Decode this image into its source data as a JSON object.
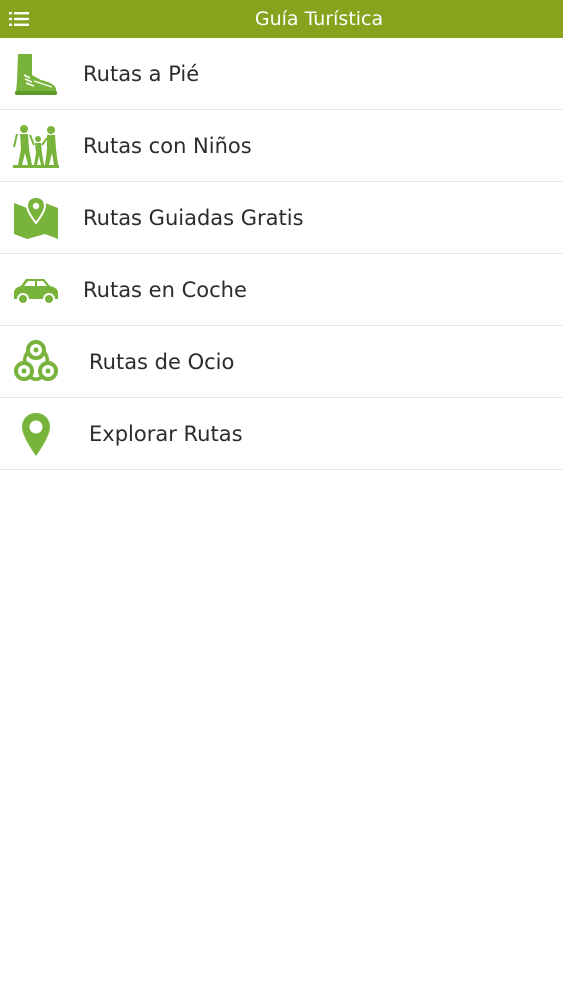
{
  "header": {
    "title": "Guía Turística",
    "accent_color": "#87a21d"
  },
  "menu": {
    "icon": "hamburger-menu-icon"
  },
  "routes": [
    {
      "label": "Rutas a Pié",
      "icon": "hiking-boot-icon"
    },
    {
      "label": "Rutas con Niños",
      "icon": "family-hikers-icon"
    },
    {
      "label": "Rutas Guiadas Gratis",
      "icon": "map-pin-icon"
    },
    {
      "label": "Rutas en Coche",
      "icon": "car-icon"
    },
    {
      "label": "Rutas de Ocio",
      "icon": "triskele-icon"
    },
    {
      "label": "Explorar Rutas",
      "icon": "location-pin-icon"
    }
  ],
  "icon_color": "#78b43b"
}
